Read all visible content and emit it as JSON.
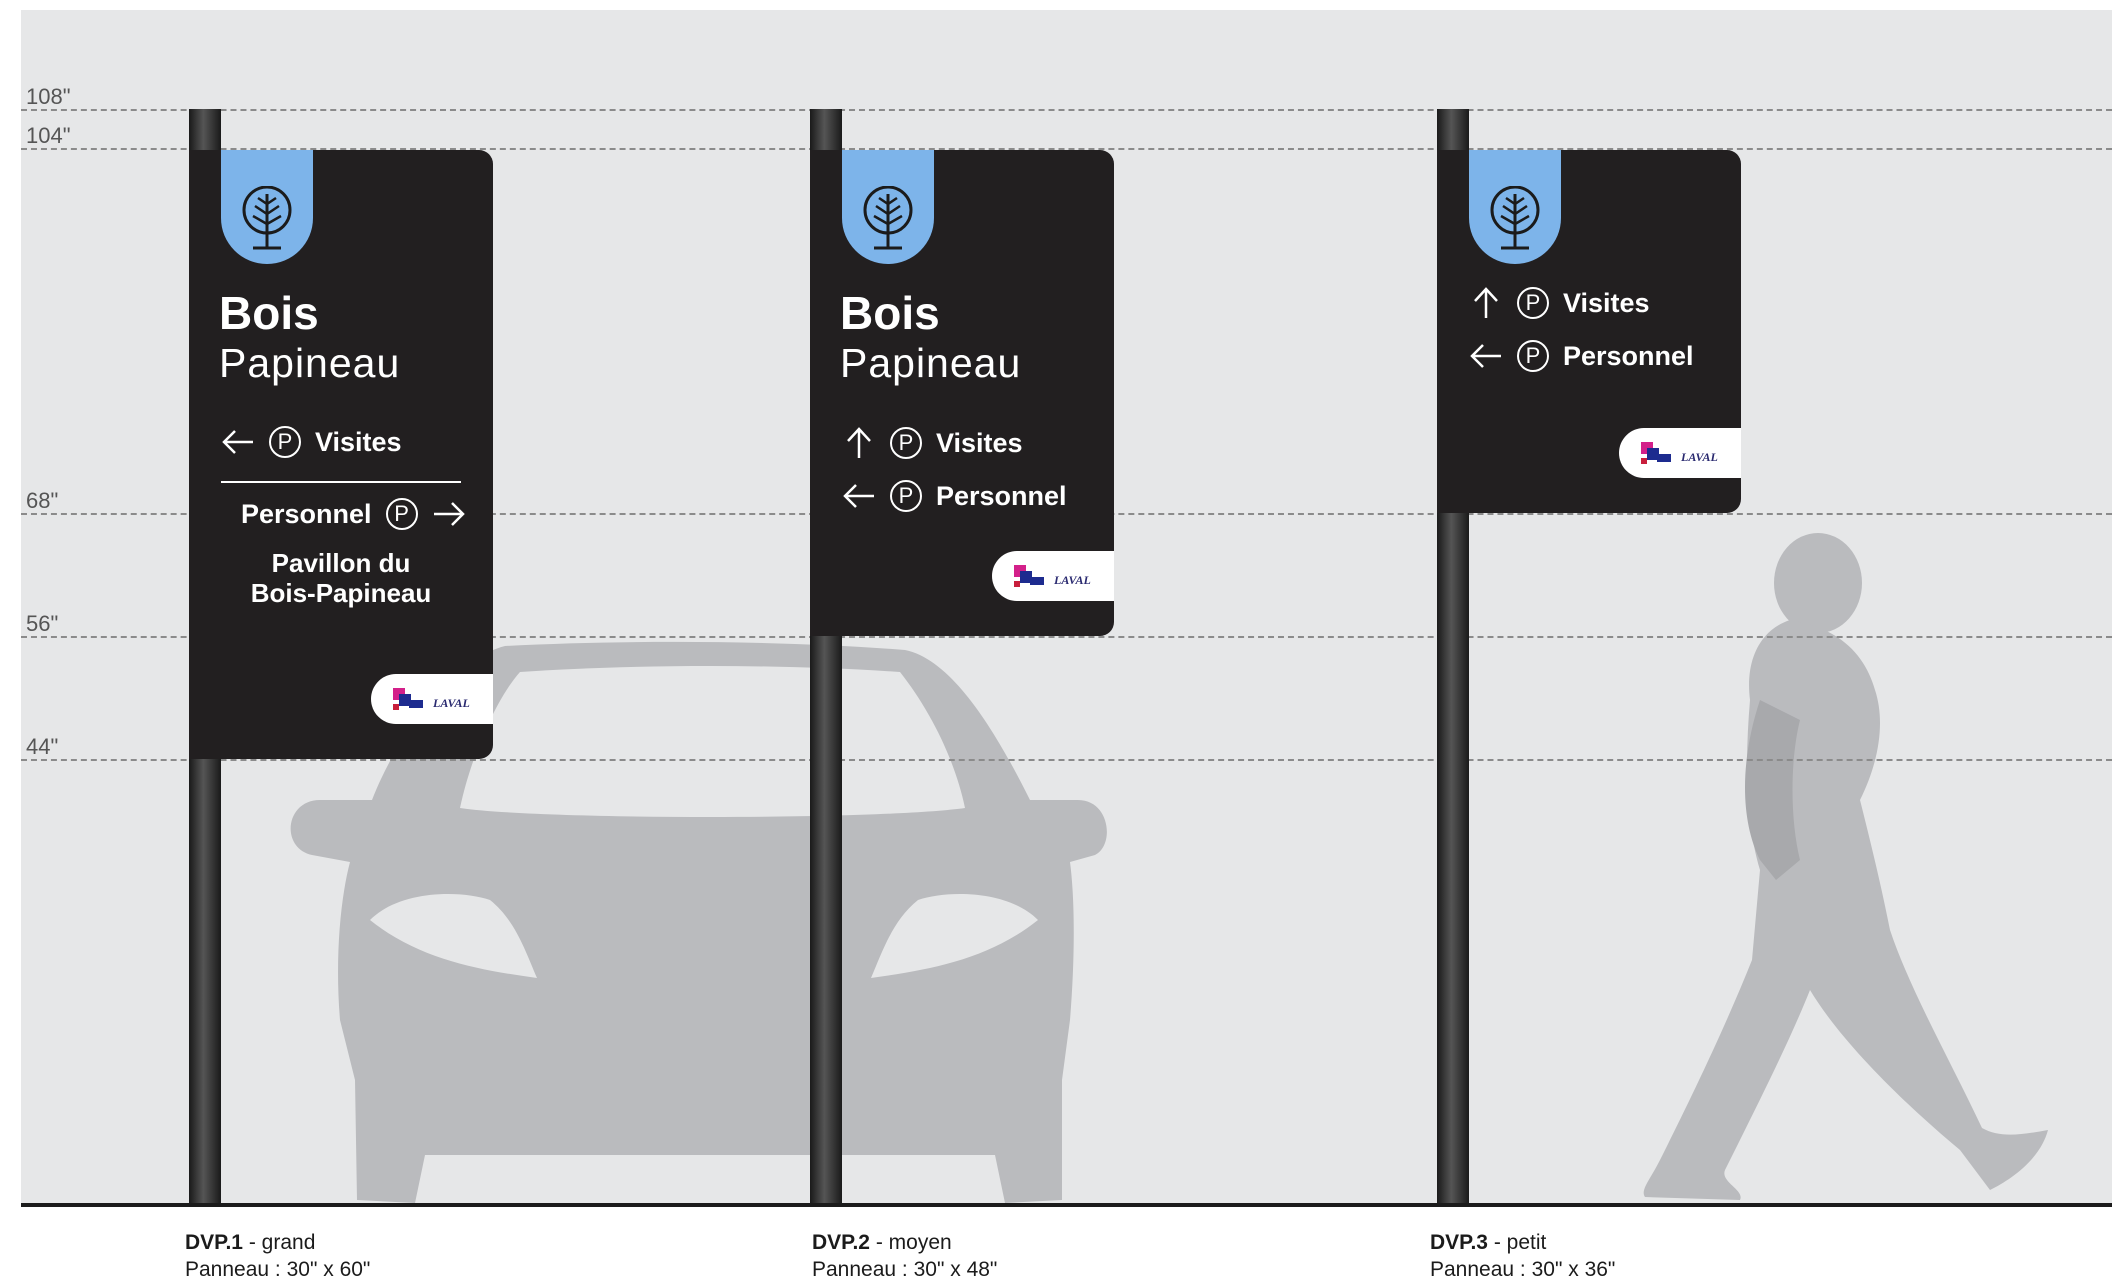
{
  "heights": [
    {
      "label": "108\"",
      "value": 108
    },
    {
      "label": "104\"",
      "value": 104
    },
    {
      "label": "68\"",
      "value": 68
    },
    {
      "label": "56\"",
      "value": 56
    },
    {
      "label": "44\"",
      "value": 44
    }
  ],
  "signs": {
    "dvp1": {
      "title": "Bois",
      "subtitle": "Papineau",
      "visites": "Visites",
      "personnel": "Personnel",
      "p": "P",
      "destination_line1": "Pavillon du",
      "destination_line2": "Bois-Papineau",
      "logo": "LAVAL"
    },
    "dvp2": {
      "title": "Bois",
      "subtitle": "Papineau",
      "visites": "Visites",
      "personnel": "Personnel",
      "p": "P",
      "logo": "LAVAL"
    },
    "dvp3": {
      "visites": "Visites",
      "personnel": "Personnel",
      "p": "P",
      "logo": "LAVAL"
    }
  },
  "captions": [
    {
      "code": "DVP.1",
      "desc": " - grand",
      "panel": "Panneau : 30\" x 60\""
    },
    {
      "code": "DVP.2",
      "desc": " - moyen",
      "panel": "Panneau : 30\" x 48\""
    },
    {
      "code": "DVP.3",
      "desc": " - petit",
      "panel": "Panneau : 30\" x 36\""
    }
  ],
  "colors": {
    "sign": "#221f20",
    "tab": "#7db4ea",
    "background": "#e6e7e8",
    "silhouette": "#babbbe"
  }
}
